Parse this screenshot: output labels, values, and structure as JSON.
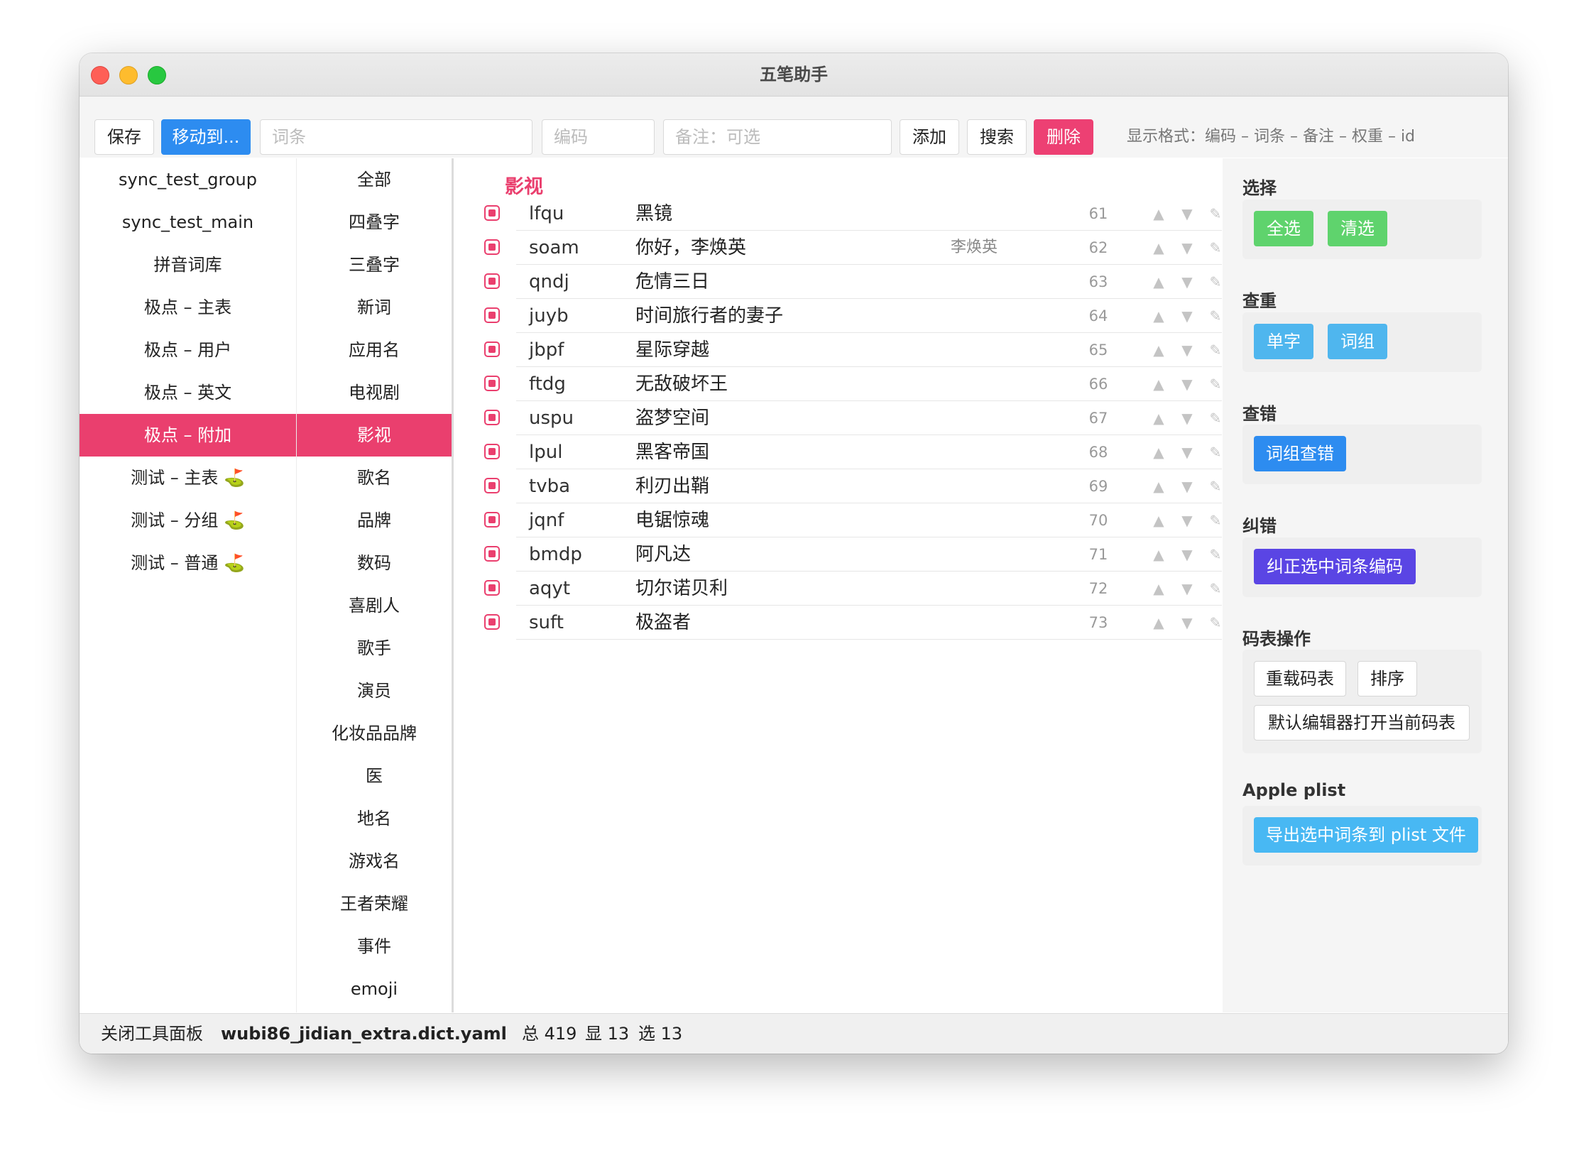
{
  "window": {
    "title": "五笔助手"
  },
  "toolbar": {
    "save": "保存",
    "move_to": "移动到...",
    "word_placeholder": "词条",
    "code_placeholder": "编码",
    "note_placeholder": "备注：可选",
    "add": "添加",
    "search": "搜索",
    "delete": "删除",
    "format_hint": "显示格式：编码 – 词条 – 备注 – 权重 – id"
  },
  "dicts": [
    "sync_test_group",
    "sync_test_main",
    "拼音词库",
    "极点 – 主表",
    "极点 – 用户",
    "极点 – 英文",
    "极点 – 附加",
    "测试 – 主表 ⛳",
    "测试 – 分组 ⛳",
    "测试 – 普通 ⛳"
  ],
  "active_dict_index": 6,
  "categories": [
    "全部",
    "四叠字",
    "三叠字",
    "新词",
    "应用名",
    "电视剧",
    "影视",
    "歌名",
    "品牌",
    "数码",
    "喜剧人",
    "歌手",
    "演员",
    "化妆品品牌",
    "医",
    "地名",
    "游戏名",
    "王者荣耀",
    "事件",
    "emoji"
  ],
  "active_category_index": 6,
  "main": {
    "section_title": "影视",
    "rows": [
      {
        "code": "lfqu",
        "word": "黑镜",
        "note": "",
        "weight": "61"
      },
      {
        "code": "soam",
        "word": "你好，李焕英",
        "note": "李焕英",
        "weight": "62"
      },
      {
        "code": "qndj",
        "word": "危情三日",
        "note": "",
        "weight": "63"
      },
      {
        "code": "juyb",
        "word": "时间旅行者的妻子",
        "note": "",
        "weight": "64"
      },
      {
        "code": "jbpf",
        "word": "星际穿越",
        "note": "",
        "weight": "65"
      },
      {
        "code": "ftdg",
        "word": "无敌破坏王",
        "note": "",
        "weight": "66"
      },
      {
        "code": "uspu",
        "word": "盗梦空间",
        "note": "",
        "weight": "67"
      },
      {
        "code": "lpul",
        "word": "黑客帝国",
        "note": "",
        "weight": "68"
      },
      {
        "code": "tvba",
        "word": "利刃出鞘",
        "note": "",
        "weight": "69"
      },
      {
        "code": "jqnf",
        "word": "电锯惊魂",
        "note": "",
        "weight": "70"
      },
      {
        "code": "bmdp",
        "word": "阿凡达",
        "note": "",
        "weight": "71"
      },
      {
        "code": "aqyt",
        "word": "切尔诺贝利",
        "note": "",
        "weight": "72"
      },
      {
        "code": "suft",
        "word": "极盗者",
        "note": "",
        "weight": "73"
      }
    ],
    "icons": {
      "up": "▲",
      "down": "▼",
      "edit": "✎",
      "delete": "✕"
    }
  },
  "sidebar": {
    "select": {
      "title": "选择",
      "select_all": "全选",
      "clear": "清选"
    },
    "dedupe": {
      "title": "查重",
      "single": "单字",
      "phrase": "词组"
    },
    "check": {
      "title": "查错",
      "phrase_check": "词组查错"
    },
    "fix": {
      "title": "纠错",
      "fix_selected": "纠正选中词条编码"
    },
    "dict_ops": {
      "title": "码表操作",
      "reload": "重载码表",
      "sort": "排序",
      "open_editor": "默认编辑器打开当前码表"
    },
    "plist": {
      "title": "Apple plist",
      "export": "导出选中词条到 plist 文件"
    }
  },
  "statusbar": {
    "close_panel": "关闭工具面板",
    "filename": "wubi86_jidian_extra.dict.yaml",
    "total": "总 419",
    "shown": "显 13",
    "selected": "选 13"
  }
}
